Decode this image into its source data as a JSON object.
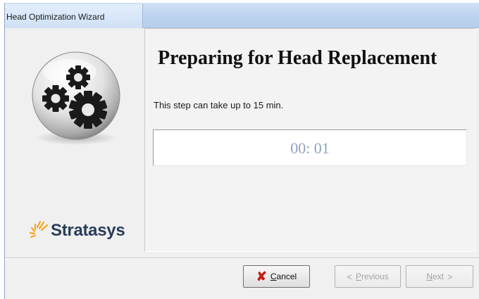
{
  "window": {
    "title": "Head Optimization Wizard"
  },
  "sidebar": {
    "graphic_icon": "gears-icon",
    "logo_text": "Stratasys",
    "logo_icon": "stratasys-logo-icon"
  },
  "main": {
    "title": "Preparing for Head Replacement",
    "description": "This step can take up to 15 min.",
    "timer": "00: 01"
  },
  "buttons": {
    "cancel": {
      "mnemonic": "C",
      "rest": "ancel",
      "icon": "cancel-x-icon",
      "enabled": true
    },
    "previous": {
      "mnemonic": "P",
      "rest": "revious",
      "icon": "arrow-left-icon",
      "enabled": false
    },
    "next": {
      "mnemonic": "N",
      "rest": "ext",
      "icon": "arrow-right-icon",
      "enabled": false
    }
  },
  "colors": {
    "accent_red": "#c41e14",
    "timer_text": "#8ea2bf",
    "logo_text": "#2a3d5a",
    "logo_mark": "#f5a623"
  }
}
